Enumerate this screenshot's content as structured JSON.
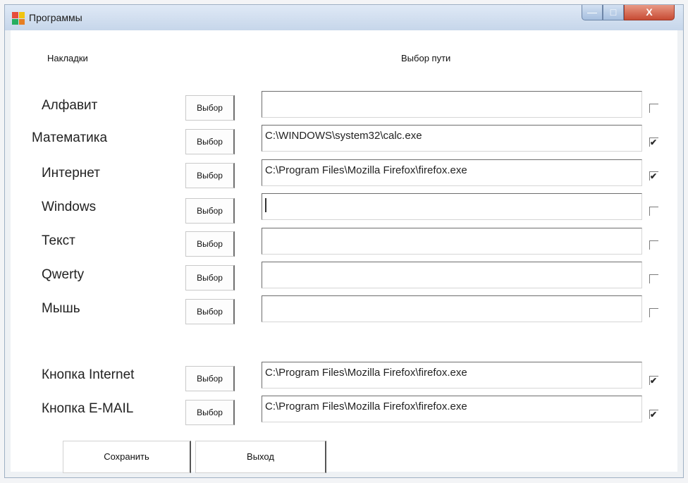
{
  "window": {
    "title": "Программы",
    "icon_colors": [
      "#e74c3c",
      "#f1c40f",
      "#27ae60",
      "#e67e22"
    ],
    "controls": {
      "minimize": "—",
      "maximize": "□",
      "close": "X"
    }
  },
  "headers": {
    "tabs": "Накладки",
    "path": "Выбор пути"
  },
  "rows": [
    {
      "label": "Алфавит",
      "button": "Выбор",
      "path": "",
      "checked": false
    },
    {
      "label": "Математика",
      "button": "Выбор",
      "path": "C:\\WINDOWS\\system32\\calc.exe",
      "checked": true
    },
    {
      "label": "Интернет",
      "button": "Выбор",
      "path": "C:\\Program Files\\Mozilla Firefox\\firefox.exe",
      "checked": true
    },
    {
      "label": "Windows",
      "button": "Выбор",
      "path": "",
      "checked": false
    },
    {
      "label": "Текст",
      "button": "Выбор",
      "path": "",
      "checked": false
    },
    {
      "label": "Qwerty",
      "button": "Выбор",
      "path": "",
      "checked": false
    },
    {
      "label": "Мышь",
      "button": "Выбор",
      "path": "",
      "checked": false
    },
    {
      "label": "Кнопка Internet",
      "button": "Выбор",
      "path": "C:\\Program Files\\Mozilla Firefox\\firefox.exe",
      "checked": true
    },
    {
      "label": "Кнопка E-MAIL",
      "button": "Выбор",
      "path": "C:\\Program Files\\Mozilla Firefox\\firefox.exe",
      "checked": true
    }
  ],
  "buttons": {
    "save": "Сохранить",
    "exit": "Выход"
  }
}
